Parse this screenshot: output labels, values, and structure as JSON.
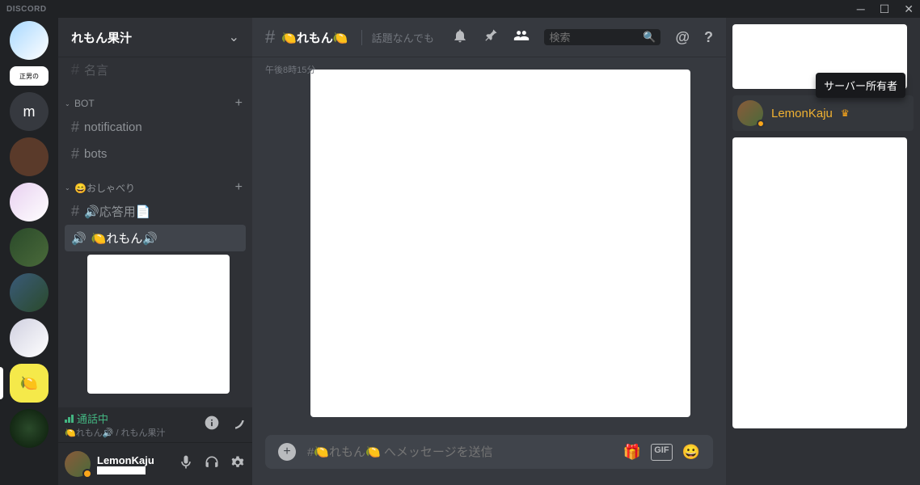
{
  "titlebar": {
    "logo": "DISCORD"
  },
  "server": {
    "name": "れもん果汁"
  },
  "guilds": {
    "m_label": "m"
  },
  "categories": {
    "bot": {
      "label": "BOT"
    },
    "chat": {
      "label": "😄おしゃべり"
    }
  },
  "channels": {
    "hidden": "名言",
    "notification": "notification",
    "bots": "bots",
    "response": "🔊応答用📄",
    "lemon_voice": "🍋れもん🔊"
  },
  "voice_panel": {
    "status": "通話中",
    "sub": "🍋れもん🔊 / れもん果汁"
  },
  "user": {
    "name": "LemonKaju"
  },
  "chat": {
    "title": "🍋れもん🍋",
    "topic": "話題なんでも",
    "timestamp": "午後8時15分",
    "placeholder": "#🍋れもん🍋 へメッセージを送信"
  },
  "search": {
    "placeholder": "検索"
  },
  "members": {
    "owner": {
      "name": "LemonKaju",
      "tooltip": "サーバー所有者"
    }
  },
  "icons": {
    "gift": "🎁",
    "gif": "GIF",
    "emoji": "😀"
  }
}
